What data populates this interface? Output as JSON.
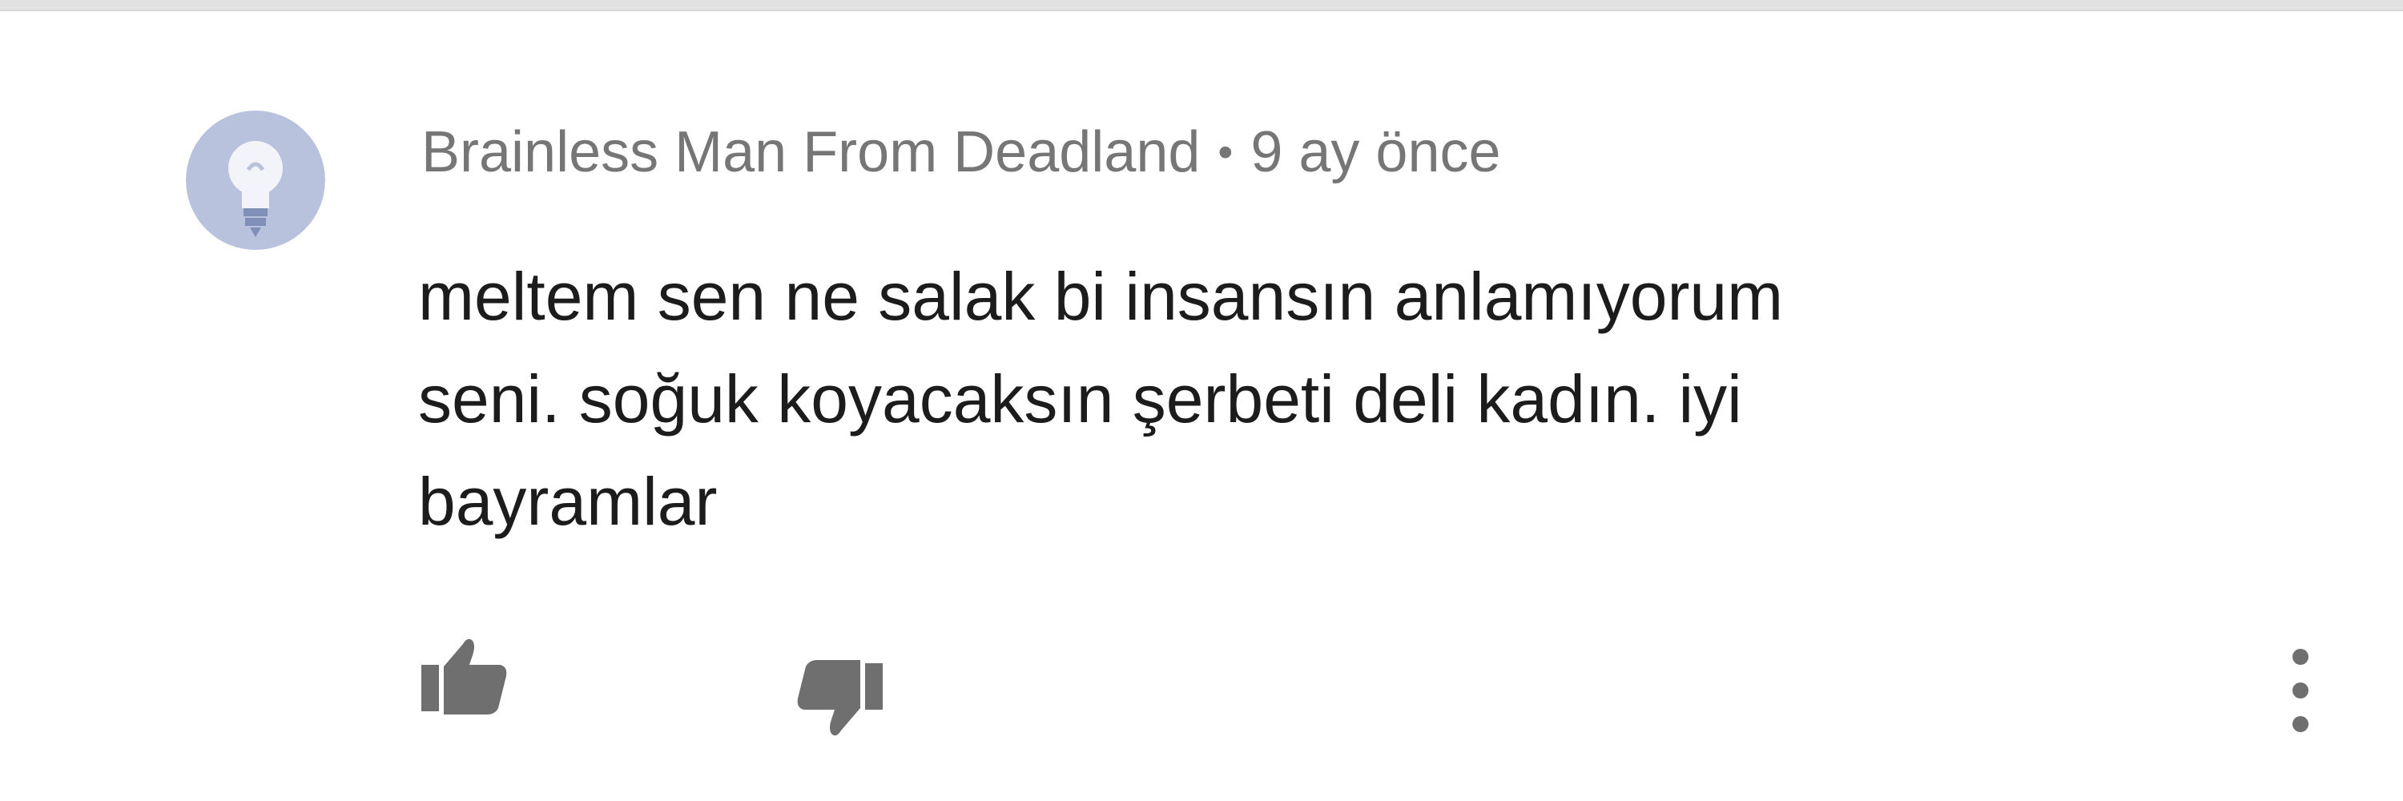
{
  "comment": {
    "author": "Brainless Man From Deadland",
    "separator": "•",
    "timestamp": "9 ay önce",
    "text": "meltem sen ne salak bi insansın anlamıyorum\nseni. soğuk koyacaksın şerbeti deli kadın. iyi\nbayramlar",
    "avatar_icon": "lightbulb-avatar-icon",
    "actions": {
      "like_icon": "thumbs-up-icon",
      "dislike_icon": "thumbs-down-icon",
      "more_icon": "more-vertical-icon"
    }
  },
  "colors": {
    "meta_text": "#767676",
    "body_text": "#1c1c1c",
    "icon": "#6f6f6f",
    "avatar_bg": "#b9c2dc",
    "avatar_fg": "#f2f4fa",
    "avatar_accent": "#7f8fb8"
  }
}
